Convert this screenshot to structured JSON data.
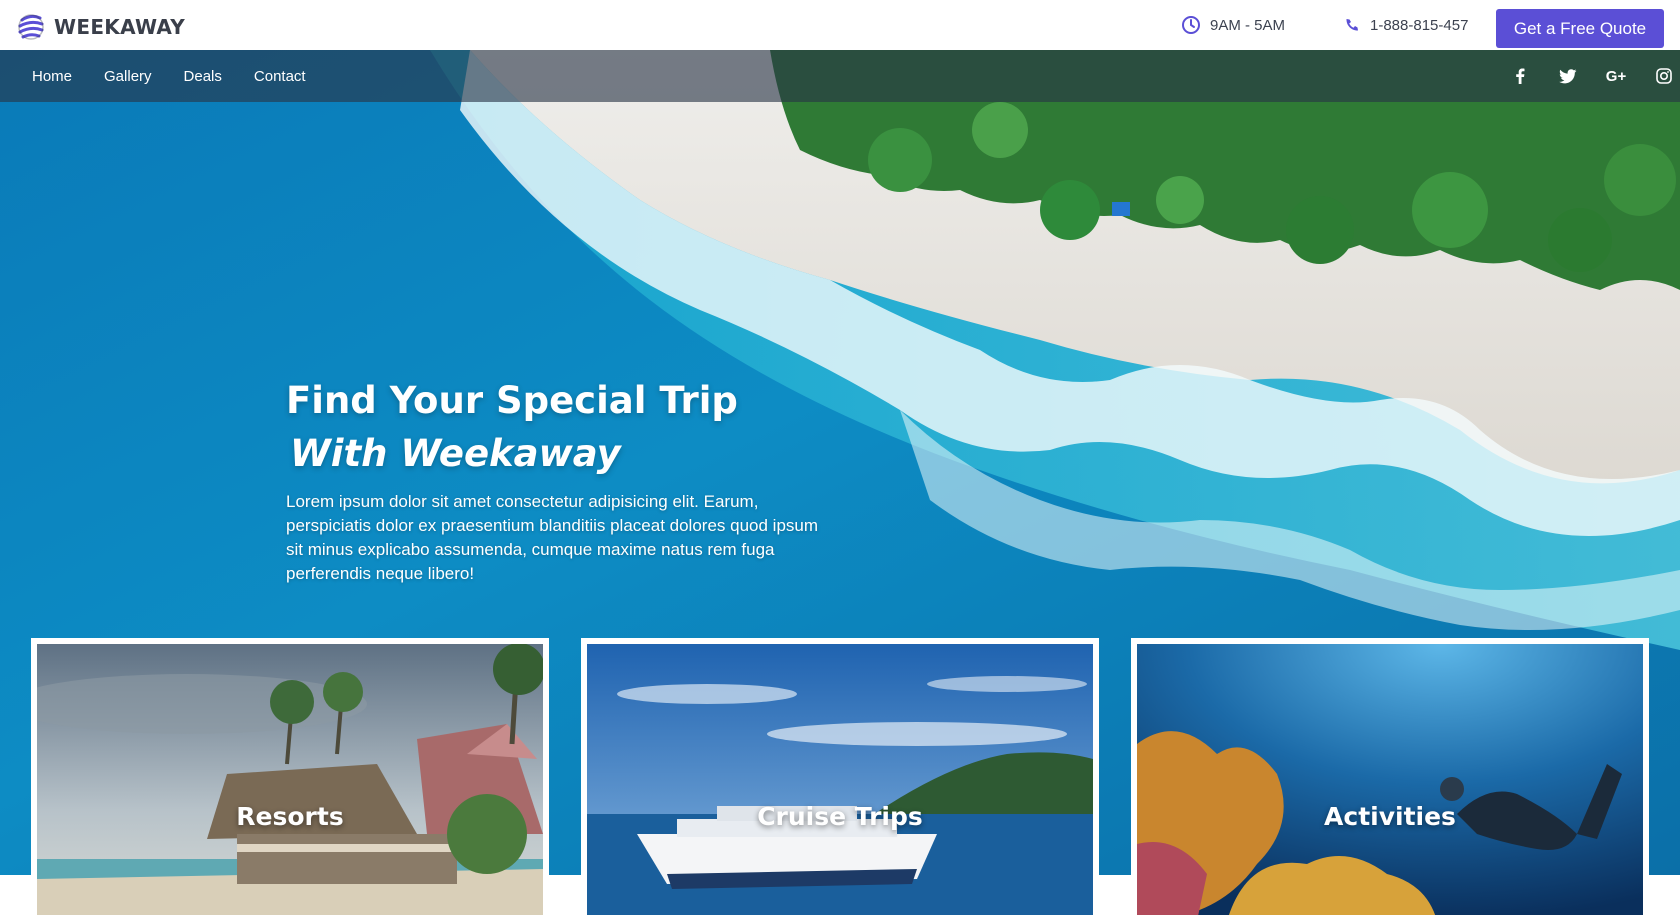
{
  "brand": {
    "name": "WEEKAWAY",
    "accent": "#5b4fd6"
  },
  "header": {
    "hours": "9AM - 5AM",
    "phone": "1-888-815-457",
    "quote_button": "Get a Free Quote",
    "hours_icon": "clock-icon",
    "phone_icon": "phone-icon"
  },
  "nav": {
    "links": [
      "Home",
      "Gallery",
      "Deals",
      "Contact"
    ],
    "socials": [
      "facebook-icon",
      "twitter-icon",
      "google-plus-icon",
      "instagram-icon"
    ],
    "google_plus_glyph": "G+"
  },
  "hero": {
    "title": "Find Your Special Trip",
    "subtitle": "With Weekaway",
    "description": "Lorem ipsum dolor sit amet consectetur adipisicing elit. Earum, perspiciatis dolor ex praesentium blanditiis placeat dolores quod ipsum sit minus explicabo assumenda, cumque maxime natus rem fuga perferendis neque libero!"
  },
  "cards": [
    {
      "label": "Resorts"
    },
    {
      "label": "Cruise Trips"
    },
    {
      "label": "Activities"
    }
  ]
}
